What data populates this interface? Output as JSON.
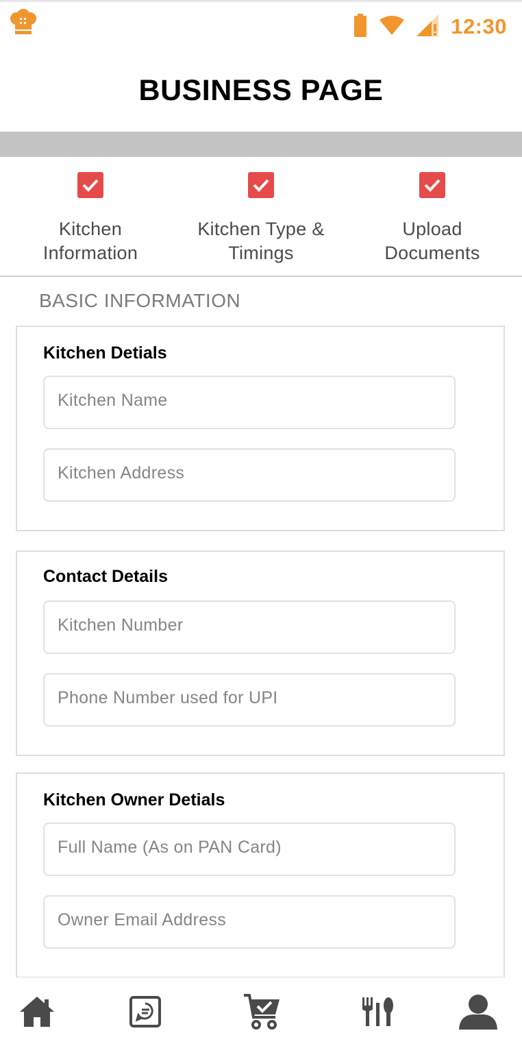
{
  "status_bar": {
    "time": "12:30",
    "accent_color": "#f0962d",
    "icons": [
      "app-logo-icon",
      "battery-icon",
      "wifi-icon",
      "cell-signal-icon"
    ]
  },
  "header": {
    "title": "BUSINESS PAGE"
  },
  "stepper": {
    "check_color": "#e54b4b",
    "steps": [
      {
        "label": "Kitchen\nInformation",
        "checked": true
      },
      {
        "label": "Kitchen Type &\nTimings",
        "checked": true
      },
      {
        "label": "Upload\nDocuments",
        "checked": true
      }
    ]
  },
  "form": {
    "section_heading": "BASIC INFORMATION",
    "cards": [
      {
        "title": "Kitchen Detials",
        "fields": [
          {
            "placeholder": "Kitchen Name",
            "value": ""
          },
          {
            "placeholder": "Kitchen Address",
            "value": ""
          }
        ]
      },
      {
        "title": "Contact Details",
        "fields": [
          {
            "placeholder": "Kitchen Number",
            "value": ""
          },
          {
            "placeholder": "Phone Number used for UPI",
            "value": ""
          }
        ]
      },
      {
        "title": "Kitchen Owner Detials",
        "fields": [
          {
            "placeholder": "Full Name (As on PAN Card)",
            "value": ""
          },
          {
            "placeholder": "Owner Email Address",
            "value": ""
          }
        ]
      }
    ]
  },
  "bottom_nav": {
    "icon_color": "#4a4a4a",
    "items": [
      "home-icon",
      "orders-chat-icon",
      "cart-check-icon",
      "menu-cutlery-icon",
      "profile-icon"
    ]
  }
}
